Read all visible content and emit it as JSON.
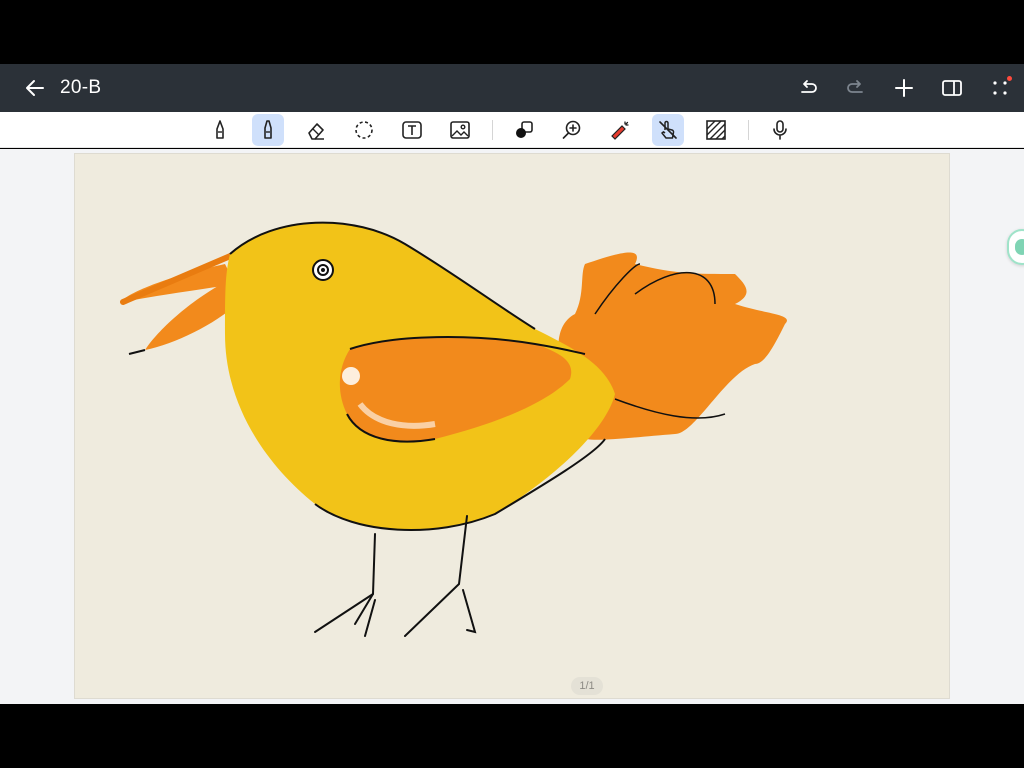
{
  "header": {
    "title": "20-B",
    "back_icon": "arrow-left-icon",
    "actions": [
      "undo-icon",
      "redo-icon",
      "add-icon",
      "sidebar-panel-icon",
      "more-icon"
    ],
    "notification_color": "#ff4a3d"
  },
  "toolbar": {
    "tools": [
      {
        "name": "pen",
        "icon": "pen-icon",
        "active": false
      },
      {
        "name": "highlighter",
        "icon": "highlighter-icon",
        "active": true
      },
      {
        "name": "eraser",
        "icon": "eraser-icon",
        "active": false
      },
      {
        "name": "lasso",
        "icon": "lasso-icon",
        "active": false
      },
      {
        "name": "text",
        "icon": "text-box-icon",
        "active": false
      },
      {
        "name": "image",
        "icon": "image-icon",
        "active": false
      },
      {
        "name": "shapes",
        "icon": "shape-icon",
        "active": false
      },
      {
        "name": "zoom",
        "icon": "zoom-in-icon",
        "active": false
      },
      {
        "name": "laser-pointer",
        "icon": "laser-pointer-icon",
        "active": false
      },
      {
        "name": "finger-draw",
        "icon": "finger-drawing-off-icon",
        "active": true
      },
      {
        "name": "background",
        "icon": "hatch-pattern-icon",
        "active": false
      },
      {
        "name": "record",
        "icon": "microphone-icon",
        "active": false
      }
    ],
    "active_color": "#cfe0fb"
  },
  "canvas": {
    "background_color": "#efebde",
    "page_indicator": "1/1",
    "drawing_description_colors": {
      "body": "#f2c318",
      "wing": "#f28a1c",
      "outline": "#111111"
    }
  }
}
